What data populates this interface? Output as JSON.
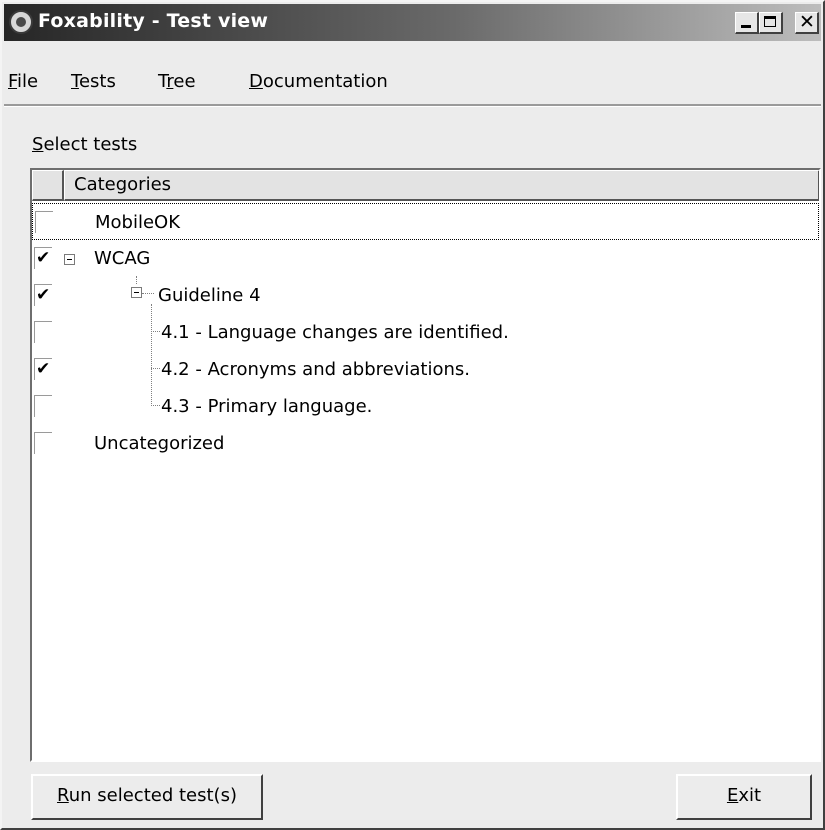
{
  "window": {
    "title": "Foxability - Test view",
    "app_icon": "foxability-logo-icon",
    "controls": {
      "minimize": "_",
      "maximize": "□",
      "close": "✕"
    }
  },
  "menu": {
    "items": [
      {
        "label": "File",
        "mnemonic": "F"
      },
      {
        "label": "Tests",
        "mnemonic": "T"
      },
      {
        "label": "Tree",
        "mnemonic": "r"
      },
      {
        "label": "Documentation",
        "mnemonic": "D"
      }
    ]
  },
  "section": {
    "label": "Select tests",
    "mnemonic": "S"
  },
  "tree": {
    "column_header": "Categories",
    "rows": [
      {
        "label": "MobileOK",
        "checked": false,
        "focused": true
      },
      {
        "label": "WCAG",
        "checked": true,
        "expander": "collapse-icon"
      },
      {
        "label": "Guideline 4",
        "checked": true,
        "expander": "collapse-icon"
      },
      {
        "label": "4.1 - Language changes are identified.",
        "checked": false
      },
      {
        "label": "4.2 - Acronyms and abbreviations.",
        "checked": true
      },
      {
        "label": "4.3 - Primary language.",
        "checked": false
      },
      {
        "label": "Uncategorized",
        "checked": false
      }
    ],
    "check_glyph": "✔"
  },
  "buttons": {
    "run": {
      "label": "Run selected test(s)",
      "mnemonic": "R"
    },
    "exit": {
      "label": "Exit",
      "mnemonic": "E"
    }
  },
  "colors": {
    "title_gradient_start": "#262626",
    "title_gradient_end": "#bdbdbd",
    "face": "#ececec",
    "tree_background": "#ffffff"
  }
}
